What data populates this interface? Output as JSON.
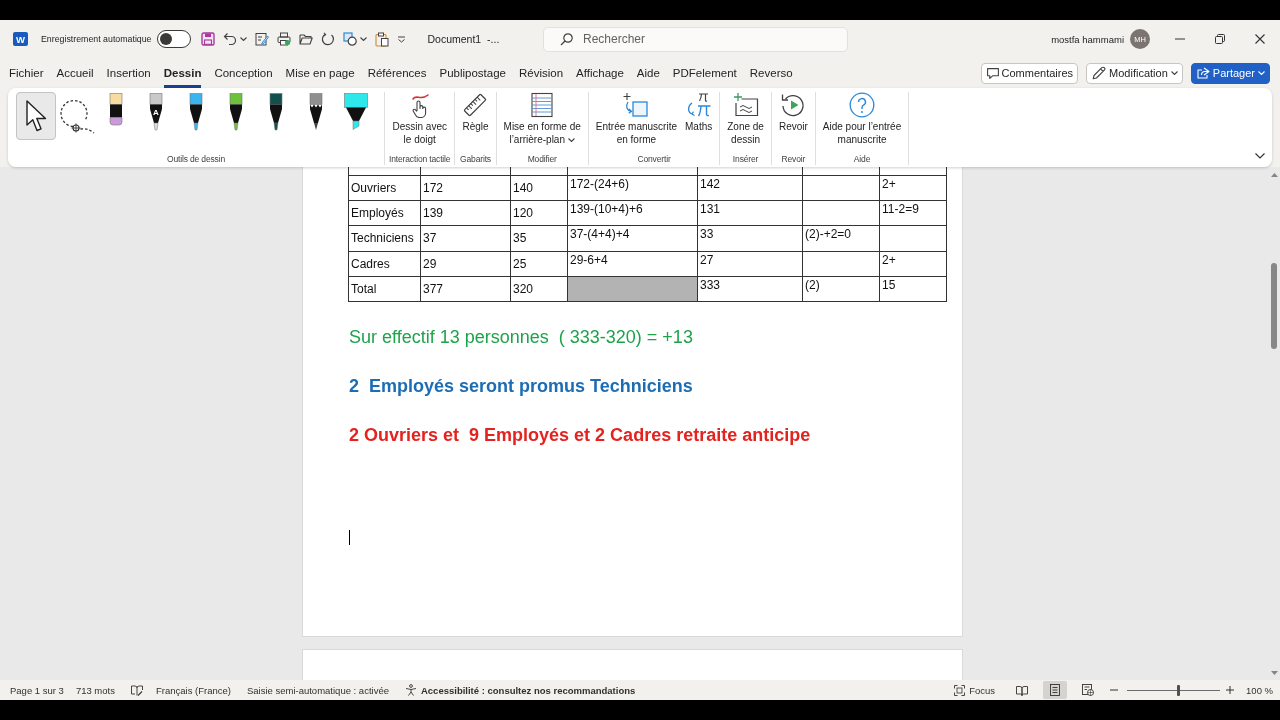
{
  "title_bar": {
    "logo_letter": "W",
    "autosave_label": "Enregistrement automatique",
    "autosave_on": false,
    "document_title": "Document1  -...",
    "search": {
      "placeholder": "Rechercher"
    },
    "user_name": "mostfa hammami",
    "avatar_initials": "MH"
  },
  "menu_tabs": [
    {
      "label": "Fichier",
      "selected": false
    },
    {
      "label": "Accueil",
      "selected": false
    },
    {
      "label": "Insertion",
      "selected": false
    },
    {
      "label": "Dessin",
      "selected": true
    },
    {
      "label": "Conception",
      "selected": false
    },
    {
      "label": "Mise en page",
      "selected": false
    },
    {
      "label": "Références",
      "selected": false
    },
    {
      "label": "Publipostage",
      "selected": false
    },
    {
      "label": "Révision",
      "selected": false
    },
    {
      "label": "Affichage",
      "selected": false
    },
    {
      "label": "Aide",
      "selected": false
    },
    {
      "label": "PDFelement",
      "selected": false
    },
    {
      "label": "Reverso",
      "selected": false
    }
  ],
  "header_buttons": [
    {
      "kind": "comments",
      "label": "Commentaires"
    },
    {
      "kind": "editing",
      "label": "Modification"
    },
    {
      "kind": "share",
      "label": "Partager"
    }
  ],
  "ribbon": {
    "tools_group": {
      "label": "Outils de dessin",
      "tools": [
        {
          "kind": "select",
          "selected": true
        },
        {
          "kind": "lasso",
          "selected": false
        },
        {
          "kind": "eraser",
          "selected": false
        },
        {
          "kind": "action_pen",
          "letter": "A",
          "selected": false
        },
        {
          "kind": "pen",
          "color": "#3ab5ef",
          "selected": false
        },
        {
          "kind": "pen",
          "color": "#6cc23a",
          "selected": false
        },
        {
          "kind": "pen",
          "color": "#12504e",
          "selected": false
        },
        {
          "kind": "pencil",
          "color": "#8f8f8f",
          "selected": false
        },
        {
          "kind": "highlighter",
          "color": "#2ee8ec",
          "selected": false
        }
      ]
    },
    "groups": [
      {
        "label": "Interaction tactile",
        "commands": [
          {
            "kind": "finger",
            "label_lines": [
              "Dessin avec",
              "le doigt"
            ],
            "dropdown": false
          }
        ]
      },
      {
        "label": "Gabarits",
        "commands": [
          {
            "kind": "ruler",
            "label_lines": [
              "Règle"
            ],
            "dropdown": false
          }
        ]
      },
      {
        "label": "Modifier",
        "commands": [
          {
            "kind": "background",
            "label_lines": [
              "Mise en forme de",
              "l’arrière-plan"
            ],
            "dropdown": true
          }
        ]
      },
      {
        "label": "Convertir",
        "commands": [
          {
            "kind": "ink_to_shape",
            "label_lines": [
              "Entrée manuscrite",
              "en forme"
            ],
            "dropdown": false
          },
          {
            "kind": "math",
            "label_lines": [
              "Maths"
            ],
            "dropdown": false
          }
        ]
      },
      {
        "label": "Insérer",
        "commands": [
          {
            "kind": "canvas",
            "label_lines": [
              "Zone de",
              "dessin"
            ],
            "dropdown": false
          }
        ]
      },
      {
        "label": "Revoir",
        "commands": [
          {
            "kind": "replay",
            "label_lines": [
              "Revoir"
            ],
            "dropdown": false
          }
        ]
      },
      {
        "label": "Aide",
        "commands": [
          {
            "kind": "help",
            "label_lines": [
              "Aide pour l’entrée",
              "manuscrite"
            ],
            "dropdown": false
          }
        ]
      }
    ]
  },
  "document": {
    "table": {
      "rows": [
        {
          "cells": [
            {
              "text": "Ouvriers",
              "shaded": false
            },
            {
              "text": "172",
              "shaded": false
            },
            {
              "text": "140",
              "shaded": false
            },
            {
              "text": "172-(24+6)",
              "shaded": false
            },
            {
              "text": "142",
              "shaded": false
            },
            {
              "shaded": false
            },
            {
              "text": "2+",
              "shaded": false
            }
          ]
        },
        {
          "cells": [
            {
              "text": "Employés",
              "shaded": false
            },
            {
              "text": "139",
              "shaded": false
            },
            {
              "text": "120",
              "shaded": false
            },
            {
              "text": "139-(10+4)+6",
              "shaded": false
            },
            {
              "text": "131",
              "shaded": false
            },
            {
              "shaded": false
            },
            {
              "text": "11-2=9",
              "shaded": false
            }
          ]
        },
        {
          "cells": [
            {
              "text": "Techniciens",
              "shaded": false
            },
            {
              "text": "37",
              "shaded": false
            },
            {
              "text": "35",
              "shaded": false
            },
            {
              "text": "37-(4+4)+4",
              "shaded": false
            },
            {
              "text": "33",
              "shaded": false
            },
            {
              "text": "(2)-+2=0",
              "shaded": false
            },
            {
              "shaded": false
            }
          ]
        },
        {
          "cells": [
            {
              "text": "Cadres",
              "shaded": false
            },
            {
              "text": "29",
              "shaded": false
            },
            {
              "text": "25",
              "shaded": false
            },
            {
              "text": "29-6+4",
              "shaded": false
            },
            {
              "text": "27",
              "shaded": false
            },
            {
              "shaded": false
            },
            {
              "text": "2+",
              "shaded": false
            }
          ]
        },
        {
          "cells": [
            {
              "text": "Total",
              "shaded": false
            },
            {
              "text": "377",
              "shaded": false
            },
            {
              "text": "320",
              "shaded": false
            },
            {
              "shaded": true
            },
            {
              "text": "333",
              "shaded": false
            },
            {
              "text": "(2)",
              "shaded": false
            },
            {
              "text": "15",
              "shaded": false
            }
          ]
        }
      ]
    },
    "paragraphs": [
      {
        "text": "Sur effectif 13 personnes  ( 333-320) = +13",
        "color": "#1ea34b",
        "bold": false
      },
      {
        "text": "2  Employés seront promus Techniciens",
        "color": "#1c6db4",
        "bold": true
      },
      {
        "text": "2 Ouvriers et  9 Employés et 2 Cadres retraite anticipe",
        "color": "#e2231f",
        "bold": true
      }
    ]
  },
  "status_bar": {
    "page": "Page 1 sur 3",
    "words": "713 mots",
    "language": "Français (France)",
    "autocomplete": "Saisie semi-automatique : activée",
    "accessibility": "Accessibilité : consultez nos recommandations",
    "focus": "Focus",
    "views": [
      {
        "kind": "read",
        "selected": false
      },
      {
        "kind": "print",
        "selected": true
      },
      {
        "kind": "web",
        "selected": false
      }
    ],
    "zoom": {
      "level": 0.55,
      "reading": "100 %"
    }
  }
}
